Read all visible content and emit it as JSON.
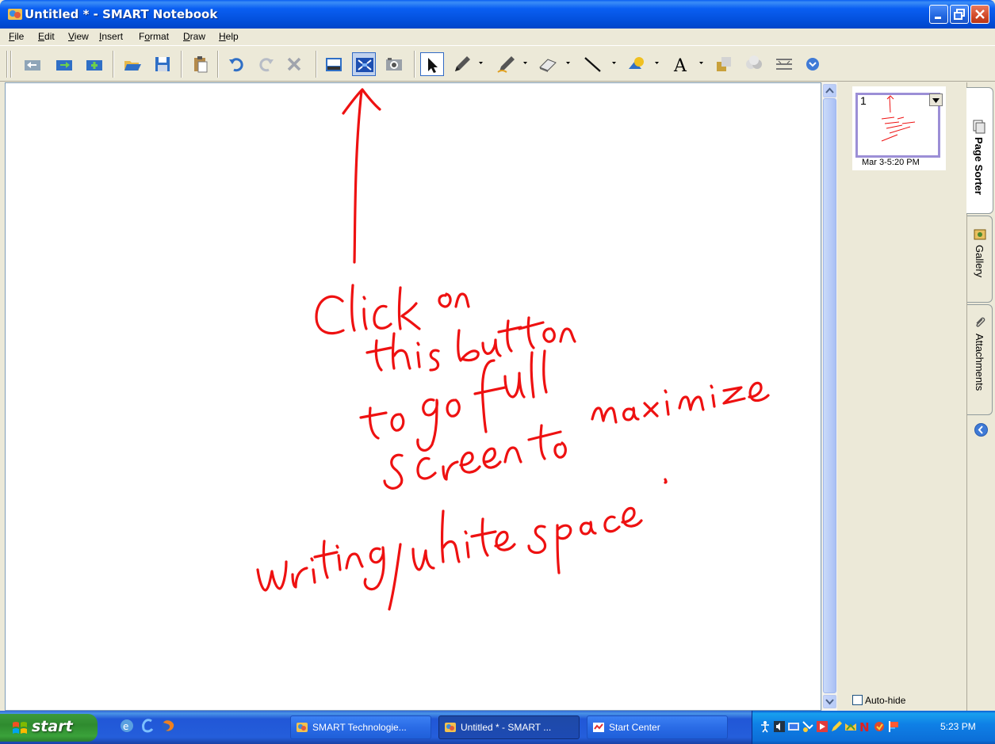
{
  "window": {
    "title": "Untitled * - SMART Notebook"
  },
  "menu": [
    {
      "label_u": "F",
      "label_rest": "ile"
    },
    {
      "label_u": "E",
      "label_rest": "dit"
    },
    {
      "label_u": "V",
      "label_rest": "iew"
    },
    {
      "label_u": "I",
      "label_rest": "nsert"
    },
    {
      "label_u": "",
      "label_pre": "F",
      "label_u2": "o",
      "label_rest": "rmat"
    },
    {
      "label_u": "D",
      "label_rest": "raw"
    },
    {
      "label_u": "H",
      "label_rest": "elp"
    }
  ],
  "menu_labels": {
    "file": {
      "u": "F",
      "rest": "ile"
    },
    "edit": {
      "u": "E",
      "rest": "dit"
    },
    "view": {
      "u": "V",
      "rest": "iew"
    },
    "insert": {
      "u": "I",
      "rest": "nsert"
    },
    "format_pre": "F",
    "format_u": "o",
    "format_rest": "rmat",
    "draw": {
      "u": "D",
      "rest": "raw"
    },
    "help": {
      "u": "H",
      "rest": "elp"
    }
  },
  "toolbar": {
    "buttons": [
      "previous-page",
      "next-page",
      "blank-page",
      "open",
      "save",
      "paste",
      "undo",
      "redo",
      "delete",
      "screen-shade",
      "full-screen",
      "capture",
      "select",
      "pen",
      "creative-pen",
      "eraser",
      "line",
      "shapes",
      "text",
      "fill",
      "properties",
      "move-toolbar",
      "more"
    ],
    "pressed": "full-screen"
  },
  "page_sorter": {
    "page_number": "1",
    "page_date": "Mar 3-5:20 PM",
    "auto_hide_label": "Auto-hide"
  },
  "tabs": {
    "page_sorter": "Page Sorter",
    "gallery": "Gallery",
    "attachments": "Attachments"
  },
  "taskbar": {
    "start_label": "start",
    "tasks": [
      {
        "label": "SMART Technologie..."
      },
      {
        "label": "Untitled * - SMART ..."
      },
      {
        "label": "Start Center"
      }
    ],
    "clock": "5:23 PM"
  },
  "colors": {
    "ink": "#ee1111",
    "titlebar": "#0a5ff2",
    "taskbar": "#245edb",
    "start": "#2f8b2f"
  }
}
